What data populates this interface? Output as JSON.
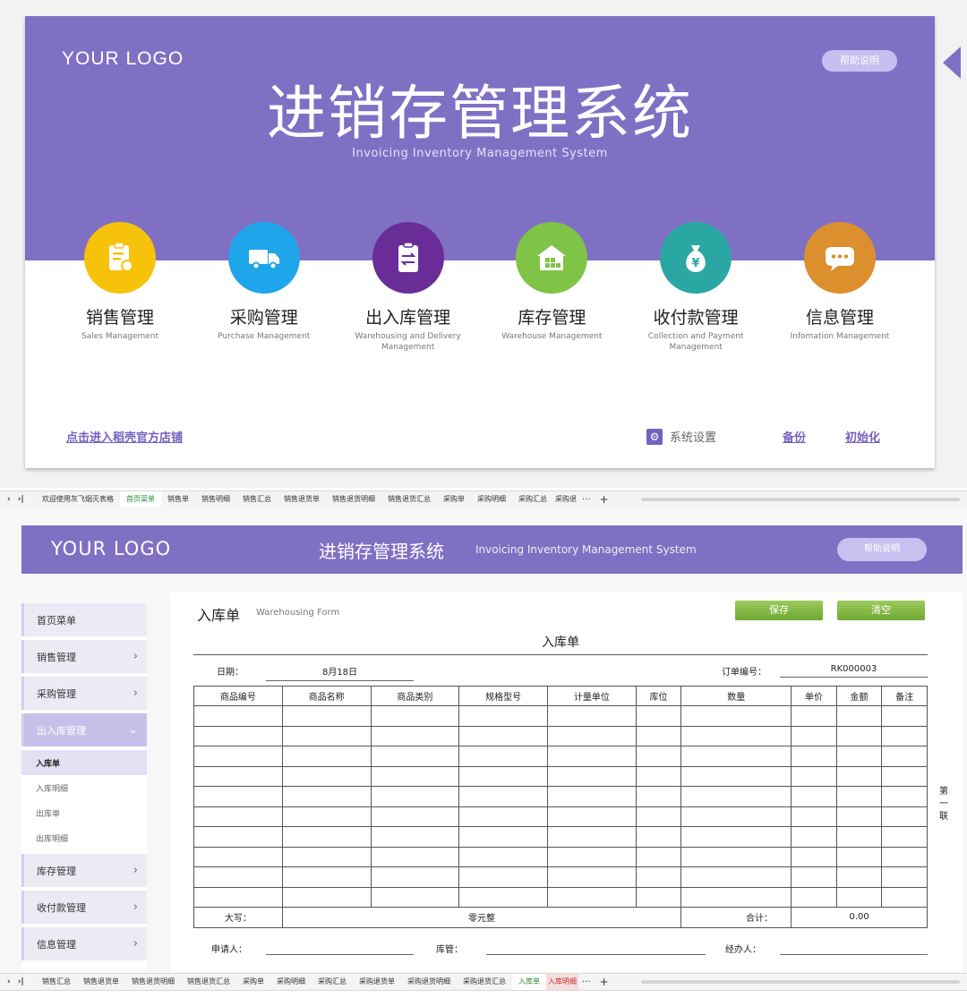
{
  "dashboard": {
    "logo": "YOUR LOGO",
    "help": "帮助说明",
    "title": "进销存管理系统",
    "subtitle": "Invoicing Inventory Management System",
    "modules": [
      {
        "name": "销售管理",
        "en": "Sales Management",
        "color": "#f7c20a",
        "icon": "clipboard-icon"
      },
      {
        "name": "采购管理",
        "en": "Purchase Management",
        "color": "#1ea5ea",
        "icon": "truck-icon"
      },
      {
        "name": "出入库管理",
        "en": "Warehousing and Delivery Management",
        "color": "#6a2d98",
        "icon": "transfer-icon"
      },
      {
        "name": "库存管理",
        "en": "Warehouse Management",
        "color": "#7fc446",
        "icon": "warehouse-icon"
      },
      {
        "name": "收付款管理",
        "en": "Collection and Payment Management",
        "color": "#2ba7a3",
        "icon": "money-bag-icon"
      },
      {
        "name": "信息管理",
        "en": "Infomation Management",
        "color": "#dc8f2d",
        "icon": "chat-icon"
      }
    ],
    "store_link": "点击进入稻壳官方店铺",
    "settings": "系统设置",
    "backup": "备份",
    "init": "初始化"
  },
  "tabbar_top": {
    "tabs": [
      "欢迎使用灰飞烟灭表格",
      "首页菜单",
      "销售单",
      "销售明细",
      "销售汇总",
      "销售退货单",
      "销售退货明细",
      "销售退货汇总",
      "采购单",
      "采购明细",
      "采购汇总",
      "采购退"
    ],
    "active": "首页菜单",
    "more": "···",
    "plus": "+"
  },
  "form_page": {
    "logo": "YOUR LOGO",
    "title": "进销存管理系统",
    "subtitle": "Invoicing Inventory Management System",
    "help": "帮助说明",
    "sidebar": [
      {
        "label": "首页菜单",
        "chevron": ""
      },
      {
        "label": "销售管理",
        "chevron": "›"
      },
      {
        "label": "采购管理",
        "chevron": "›"
      },
      {
        "label": "出入库管理",
        "chevron": "⌄",
        "open": true,
        "children": [
          "入库单",
          "入库明细",
          "出库单",
          "出库明细"
        ]
      },
      {
        "label": "库存管理",
        "chevron": "›"
      },
      {
        "label": "收付款管理",
        "chevron": "›"
      },
      {
        "label": "信息管理",
        "chevron": "›"
      }
    ],
    "form_title": "入库单",
    "form_title_en": "Warehousing Form",
    "save": "保存",
    "clear": "清空",
    "heading": "入库单",
    "date_label": "日期：",
    "date_value": "8月18日",
    "order_label": "订单编号：",
    "order_value": "RK000003",
    "columns": [
      "商品编号",
      "商品名称",
      "商品类别",
      "规格型号",
      "计量单位",
      "库位",
      "数量",
      "单价",
      "金额",
      "备注"
    ],
    "empty_rows": 10,
    "capital_label": "大写：",
    "capital_value": "零元整",
    "total_label": "合计：",
    "total_value": "0.00",
    "applicant": "申请人：",
    "keeper": "库管：",
    "handler": "经办人：",
    "copy_note": "第一联"
  },
  "tabbar_bottom": {
    "tabs": [
      "销售汇总",
      "销售退货单",
      "销售退货明细",
      "销售退货汇总",
      "采购单",
      "采购明细",
      "采购汇总",
      "采购退货单",
      "采购退货明细",
      "采购退货汇总",
      "入库单",
      "入库明细"
    ],
    "active": "入库单",
    "pink": "入库明细",
    "more": "···",
    "plus": "+"
  }
}
